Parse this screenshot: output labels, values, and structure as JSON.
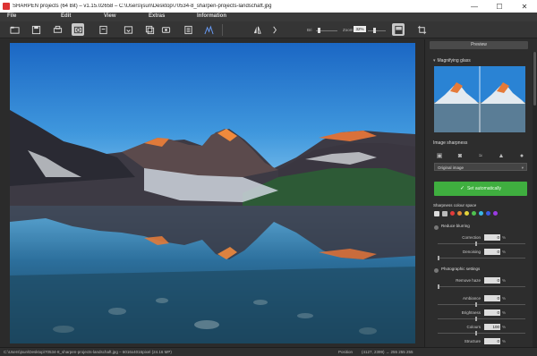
{
  "window": {
    "title": "SHARPEN projects (64 Bit) – v1.15.02658 – C:\\Users\\jsun\\Desktop\\70534-8_sharpen-projects-landschaft.jpg",
    "minimize": "—",
    "maximize": "☐",
    "close": "✕"
  },
  "menu": {
    "items": [
      "File",
      "Edit",
      "View",
      "Extras",
      "Information"
    ]
  },
  "toolbar": {
    "zoom_label": "Zoom",
    "zoom_value": "32%",
    "bri_label": "Bri",
    "icons": [
      "open-icon",
      "save-icon",
      "print-icon",
      "photo-icon",
      "export-icon",
      "import-icon",
      "batch-icon",
      "info-icon",
      "histogram-icon",
      "compare-icon",
      "next-icon",
      "split-icon",
      "crop-icon"
    ]
  },
  "panel": {
    "preview_button": "Preview",
    "magnifier_title": "Magnifying glass",
    "image_sharpness_title": "Image sharpness",
    "image_mode": "Original image",
    "autosharpen_button": "Set automatically",
    "color_areas_title": "Sharpness colour space",
    "noise_title": "Reduce blurring",
    "correction_label": "Correction",
    "correction_value": "0",
    "denoising_label": "Denoising",
    "denoising_value": "0",
    "photo_title": "Photographic settings",
    "remove_haze_label": "Remove haze",
    "remove_haze_value": "0",
    "ambiance_label": "Ambiance",
    "ambiance_value": "0",
    "brightness_label": "Brightness",
    "brightness_value": "0",
    "colors_label": "Colours",
    "colors_value": "100",
    "structure_label": "Structure",
    "structure_value": "0",
    "unit": "%",
    "swatch_colors": [
      "#e33b3b",
      "#e3873b",
      "#e3d33b",
      "#4fc14f",
      "#3bb7e3",
      "#3b5be3",
      "#9b3be3"
    ]
  },
  "status": {
    "path": "C:\\Users\\jsun\\Desktop\\70534-8_sharpen-projects-landschaft.jpg – 6016x4016pixel (24.16 MP)",
    "position_label": "Position",
    "position_value": "(4127, 2399) → 255 255 255"
  }
}
